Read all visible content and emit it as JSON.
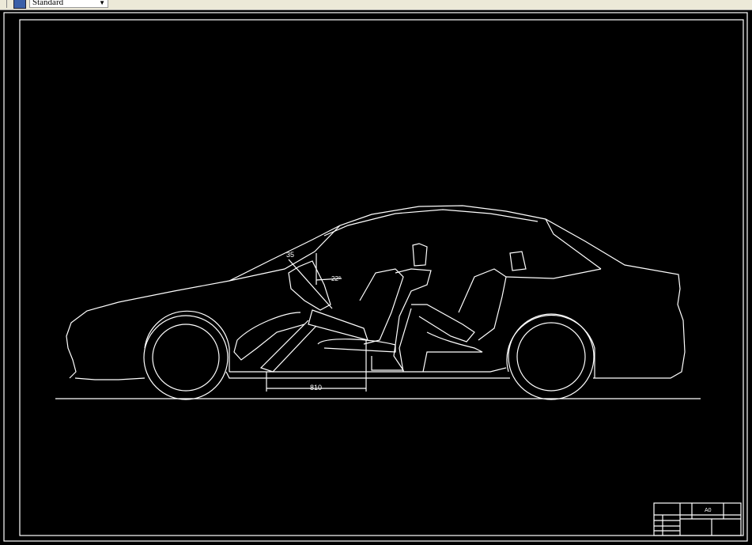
{
  "toolbar": {
    "text_style": "Standard",
    "style_icon": "text-style-icon"
  },
  "drawing": {
    "background": "#000000",
    "line_color": "#ffffff",
    "dimensions": {
      "angle_top": "35",
      "angle_side": "22°",
      "floor_length": "810"
    },
    "title_block": {
      "sheet_size": "A0"
    }
  }
}
